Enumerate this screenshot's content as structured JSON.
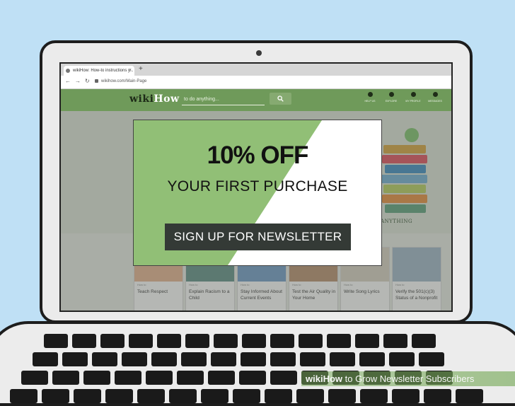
{
  "browser": {
    "tab_title": "wikiHow: How-to instructions y...",
    "tab_close": "×",
    "new_tab": "+",
    "url": "wikihow.com/Main-Page"
  },
  "site": {
    "logo_dark": "wiki",
    "logo_light": "How",
    "search_placeholder": "to do anything...",
    "nav": [
      {
        "label": "HELP US"
      },
      {
        "label": "EXPLORE"
      },
      {
        "label": "MY PROFILE"
      },
      {
        "label": "MESSAGES"
      }
    ],
    "hero_text": "ANYTHING"
  },
  "popup": {
    "headline": "10% OFF",
    "subheadline": "YOUR FIRST PURCHASE",
    "cta_label": "SIGN UP FOR NEWSLETTER"
  },
  "cards": [
    {
      "howto": "How to",
      "title": "Teach Respect"
    },
    {
      "howto": "How to",
      "title": "Explain Racism to a Child"
    },
    {
      "howto": "How to",
      "title": "Stay Informed About Current Events"
    },
    {
      "howto": "How to",
      "title": "Test the Air Quality in Your Home"
    },
    {
      "howto": "How to",
      "title": "Write Song Lyrics"
    },
    {
      "howto": "How to",
      "title": "Verify the 501(c)(3) Status of a Nonprofit"
    }
  ],
  "watermark": {
    "brand_bold": "wikiHow",
    "text": " to Grow Newsletter Subscribers"
  },
  "colors": {
    "background": "#bfe0f5",
    "site_green": "#6f9a5a",
    "popup_green": "#91bf76",
    "cta_dark": "#343a36"
  }
}
